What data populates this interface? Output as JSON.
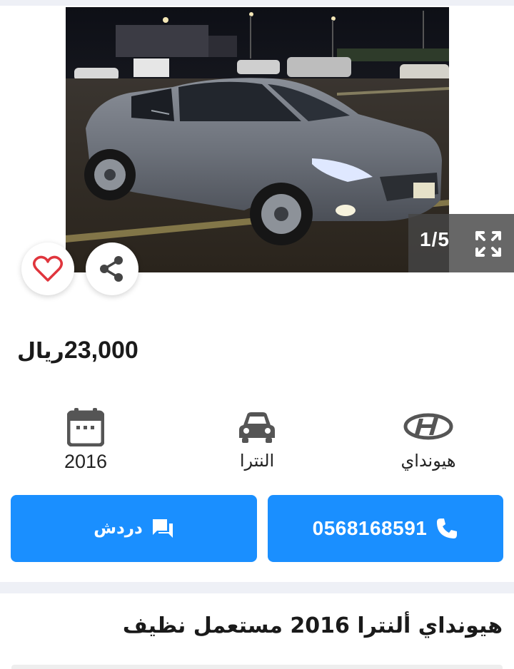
{
  "gallery": {
    "counter": "1/5",
    "icons": {
      "prev": "chevron-left-icon",
      "next": "chevron-right-icon",
      "expand": "expand-icon",
      "favorite": "heart-icon",
      "share": "share-icon"
    }
  },
  "price": {
    "amount": "23,000",
    "currency": "ريال"
  },
  "specs": {
    "year": "2016",
    "model": "النترا",
    "make": "هيونداي"
  },
  "actions": {
    "chat_label": "دردش",
    "phone": "0568168591"
  },
  "listing": {
    "title": "هيونداي ألنترا 2016 مستعمل نظيف"
  },
  "colors": {
    "accent": "#1a8fff",
    "favorite": "#e0353d"
  }
}
